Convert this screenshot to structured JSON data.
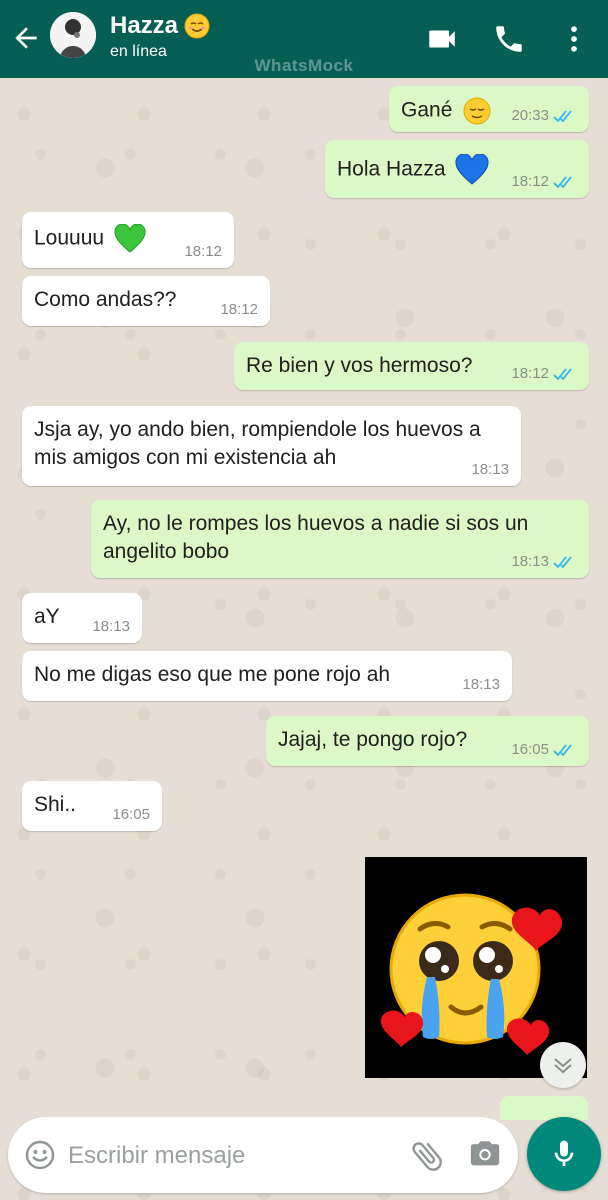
{
  "header": {
    "contact_name": "Hazza",
    "status": "en línea",
    "watermark": "WhatsMock"
  },
  "messages": [
    {
      "direction": "out",
      "text": "Gané",
      "emoji": "relieved-face",
      "time": "20:33",
      "read": true
    },
    {
      "direction": "out",
      "text": "Hola Hazza",
      "emoji": "blue-heart",
      "time": "18:12",
      "read": true
    },
    {
      "direction": "in",
      "text": "Louuuu",
      "emoji": "green-heart",
      "time": "18:12"
    },
    {
      "direction": "in",
      "text": "Como andas??",
      "time": "18:12"
    },
    {
      "direction": "out",
      "text": "Re bien y vos hermoso?",
      "time": "18:12",
      "read": true
    },
    {
      "direction": "in",
      "text": "Jsja ay, yo ando bien, rompiendole los huevos a mis amigos con mi existencia ah",
      "time": "18:13"
    },
    {
      "direction": "out",
      "text": "Ay, no le rompes los huevos a nadie si sos un angelito bobo",
      "time": "18:13",
      "read": true
    },
    {
      "direction": "in",
      "text": "aY",
      "time": "18:13"
    },
    {
      "direction": "in",
      "text": "No me digas eso que me pone rojo ah",
      "time": "18:13"
    },
    {
      "direction": "out",
      "text": "Jajaj, te pongo rojo?",
      "time": "16:05",
      "read": true
    },
    {
      "direction": "in",
      "text": "Shi..",
      "time": "16:05"
    },
    {
      "direction": "out",
      "type": "image",
      "image": "pleading-face-with-hearts"
    }
  ],
  "input": {
    "placeholder": "Escribir mensaje"
  },
  "colors": {
    "header": "#075e54",
    "outgoing_bubble": "#dcf8c6",
    "incoming_bubble": "#ffffff",
    "read_ticks": "#34b7f1",
    "mic_button": "#00897b"
  },
  "icons": [
    "back-arrow-icon",
    "video-call-icon",
    "phone-icon",
    "more-vert-icon",
    "emoji-icon",
    "attach-icon",
    "camera-icon",
    "mic-icon",
    "scroll-down-icon"
  ]
}
